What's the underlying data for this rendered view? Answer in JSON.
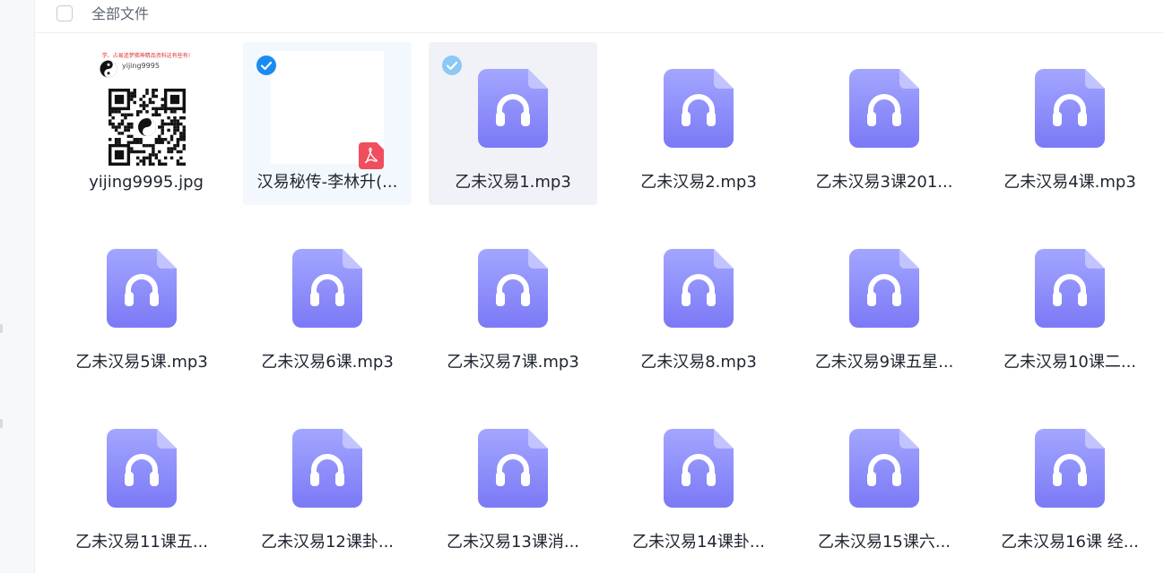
{
  "header": {
    "title": "全部文件"
  },
  "qr_thumb": {
    "tagline": "学、占易追梦佛神精品资料这有些有!",
    "username": "yijing9995"
  },
  "files": [
    {
      "name": "yijing9995.jpg",
      "type": "image",
      "selected": false
    },
    {
      "name": "汉易秘传-李林升(...",
      "type": "pdf",
      "selected": true,
      "selection_style": "checked-blue"
    },
    {
      "name": "乙未汉易1.mp3",
      "type": "audio",
      "selected": false,
      "selection_style": "hover-check"
    },
    {
      "name": "乙未汉易2.mp3",
      "type": "audio",
      "selected": false
    },
    {
      "name": "乙未汉易3课201...",
      "type": "audio",
      "selected": false
    },
    {
      "name": "乙未汉易4课.mp3",
      "type": "audio",
      "selected": false
    },
    {
      "name": "乙未汉易5课.mp3",
      "type": "audio",
      "selected": false
    },
    {
      "name": "乙未汉易6课.mp3",
      "type": "audio",
      "selected": false
    },
    {
      "name": "乙未汉易7课.mp3",
      "type": "audio",
      "selected": false
    },
    {
      "name": "乙未汉易8.mp3",
      "type": "audio",
      "selected": false
    },
    {
      "name": "乙未汉易9课五星...",
      "type": "audio",
      "selected": false
    },
    {
      "name": "乙未汉易10课二...",
      "type": "audio",
      "selected": false
    },
    {
      "name": "乙未汉易11课五...",
      "type": "audio",
      "selected": false
    },
    {
      "name": "乙未汉易12课卦...",
      "type": "audio",
      "selected": false
    },
    {
      "name": "乙未汉易13课消...",
      "type": "audio",
      "selected": false
    },
    {
      "name": "乙未汉易14课卦...",
      "type": "audio",
      "selected": false
    },
    {
      "name": "乙未汉易15课六...",
      "type": "audio",
      "selected": false
    },
    {
      "name": "乙未汉易16课 经...",
      "type": "audio",
      "selected": false
    }
  ],
  "colors": {
    "audio_icon_top": "#a3a6ff",
    "audio_icon_bottom": "#7b79f6",
    "check_blue": "#1a8cf0",
    "check_light": "#8cc8f5",
    "pdf_badge": "#f04e5e"
  }
}
